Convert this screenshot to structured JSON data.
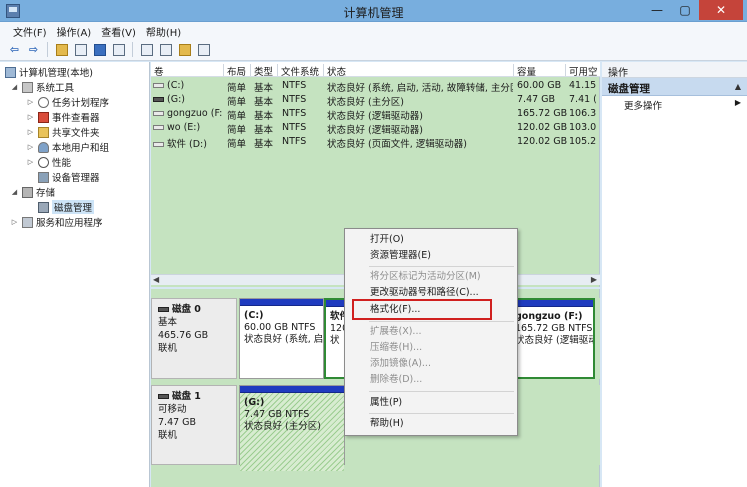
{
  "window": {
    "title": "计算机管理",
    "minimize": "—",
    "maximize": "▢",
    "close": "✕"
  },
  "menubar": [
    "文件(F)",
    "操作(A)",
    "查看(V)",
    "帮助(H)"
  ],
  "toolbar_icons": [
    "back-arrow-icon",
    "forward-arrow-icon",
    "up-folder-icon",
    "show-hide-tree-icon",
    "help-icon",
    "properties-icon",
    "refresh-icon",
    "export-icon",
    "folder-icon",
    "disk-settings-icon"
  ],
  "tree": {
    "root": "计算机管理(本地)",
    "system_tools": "系统工具",
    "task_scheduler": "任务计划程序",
    "event_viewer": "事件查看器",
    "shared_folders": "共享文件夹",
    "local_users": "本地用户和组",
    "performance": "性能",
    "device_manager": "设备管理器",
    "storage": "存储",
    "disk_management": "磁盘管理",
    "services": "服务和应用程序"
  },
  "columns": [
    "卷",
    "布局",
    "类型",
    "文件系统",
    "状态",
    "容量",
    "可用空"
  ],
  "volumes": [
    {
      "name": "(C:)",
      "layout": "简单",
      "type": "基本",
      "fs": "NTFS",
      "status": "状态良好 (系统, 启动, 活动, 故障转储, 主分区)",
      "capacity": "60.00 GB",
      "free": "41.15"
    },
    {
      "name": "(G:)",
      "layout": "简单",
      "type": "基本",
      "fs": "NTFS",
      "status": "状态良好 (主分区)",
      "capacity": "7.47 GB",
      "free": "7.41 ("
    },
    {
      "name": "gongzuo (F:)",
      "layout": "简单",
      "type": "基本",
      "fs": "NTFS",
      "status": "状态良好 (逻辑驱动器)",
      "capacity": "165.72 GB",
      "free": "106.3"
    },
    {
      "name": "wo (E:)",
      "layout": "简单",
      "type": "基本",
      "fs": "NTFS",
      "status": "状态良好 (逻辑驱动器)",
      "capacity": "120.02 GB",
      "free": "103.0"
    },
    {
      "name": "软件 (D:)",
      "layout": "简单",
      "type": "基本",
      "fs": "NTFS",
      "status": "状态良好 (页面文件, 逻辑驱动器)",
      "capacity": "120.02 GB",
      "free": "105.2"
    }
  ],
  "disk0": {
    "name": "磁盘 0",
    "kind": "基本",
    "size": "465.76 GB",
    "state": "联机",
    "parts": [
      {
        "name": "(C:)",
        "size": "60.00 GB NTFS",
        "status": "状态良好 (系统, 启"
      },
      {
        "name": "软件",
        "size": "120",
        "status": "状"
      },
      {
        "name": "gongzuo  (F:)",
        "size": "165.72 GB NTFS",
        "status": "状态良好 (逻辑驱动器)"
      }
    ]
  },
  "disk1": {
    "name": "磁盘 1",
    "kind": "可移动",
    "size": "7.47 GB",
    "state": "联机",
    "parts": [
      {
        "name": "(G:)",
        "size": "7.47 GB NTFS",
        "status": "状态良好 (主分区)"
      }
    ]
  },
  "actions": {
    "header": "操作",
    "section": "磁盘管理",
    "more": "更多操作"
  },
  "context_menu": [
    {
      "label": "打开(O)",
      "enabled": true
    },
    {
      "label": "资源管理器(E)",
      "enabled": true
    },
    {
      "label": "将分区标记为活动分区(M)",
      "enabled": false
    },
    {
      "label": "更改驱动器号和路径(C)...",
      "enabled": true
    },
    {
      "label": "格式化(F)...",
      "enabled": true
    },
    {
      "label": "扩展卷(X)...",
      "enabled": false
    },
    {
      "label": "压缩卷(H)...",
      "enabled": false
    },
    {
      "label": "添加镜像(A)...",
      "enabled": false
    },
    {
      "label": "删除卷(D)...",
      "enabled": false
    },
    {
      "label": "属性(P)",
      "enabled": true
    },
    {
      "label": "帮助(H)",
      "enabled": true
    }
  ]
}
